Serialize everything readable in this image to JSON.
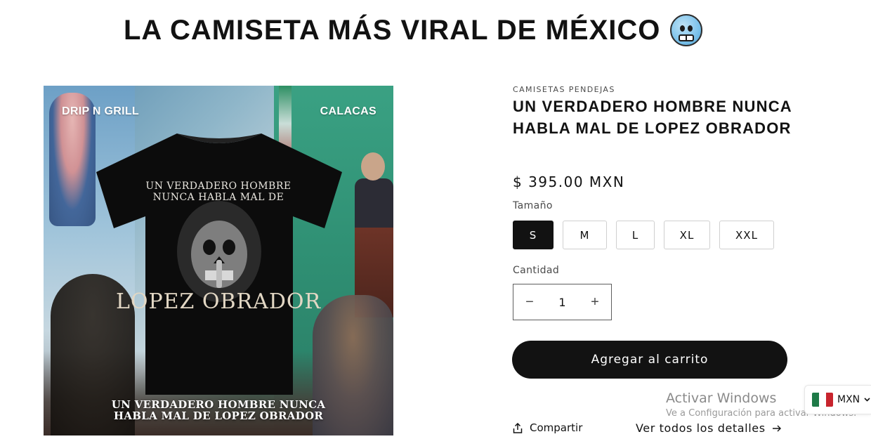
{
  "banner": {
    "title": "LA CAMISETA MÁS VIRAL DE MÉXICO",
    "emoji": "cold-face-emoji"
  },
  "product_image": {
    "tag_left": "DRIP N GRILL",
    "tag_right": "CALACAS",
    "shirt_text_top_line1": "UN VERDADERO HOMBRE",
    "shirt_text_top_line2": "NUNCA HABLA MAL DE",
    "shirt_text_big": "LOPEZ OBRADOR",
    "caption_line1": "UN VERDADERO HOMBRE NUNCA",
    "caption_line2": "HABLA MAL DE LOPEZ OBRADOR"
  },
  "product": {
    "vendor": "CAMISETAS PENDEJAS",
    "title": "UN VERDADERO HOMBRE NUNCA HABLA MAL DE LOPEZ OBRADOR",
    "price": "$ 395.00 MXN",
    "size_label": "Tamaño",
    "sizes": [
      "S",
      "M",
      "L",
      "XL",
      "XXL"
    ],
    "selected_size": "S",
    "quantity_label": "Cantidad",
    "quantity": "1",
    "minus_symbol": "−",
    "plus_symbol": "+",
    "add_to_cart": "Agregar al carrito",
    "share": "Compartir",
    "details_link": "Ver todos los detalles"
  },
  "windows_watermark": {
    "title": "Activar Windows",
    "subtitle": "Ve a Configuración para activar Windows."
  },
  "currency_selector": {
    "code": "MXN",
    "flag": "mexico-flag-icon"
  },
  "colors": {
    "primary": "#121212",
    "border": "#cfcfcf",
    "text_muted": "#4a4a4a"
  }
}
